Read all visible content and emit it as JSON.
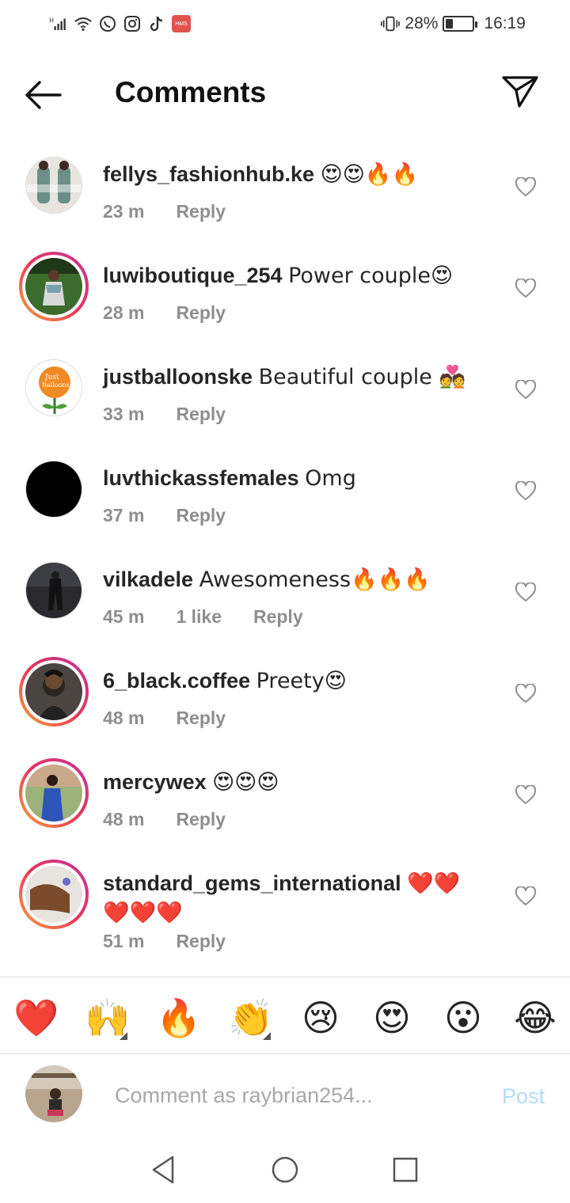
{
  "status_bar": {
    "signal_text": "H",
    "battery_text": "28%",
    "battery_level": 0.28,
    "time": "16:19",
    "icons": [
      "signal-icon",
      "wifi-icon",
      "whatsapp-icon",
      "instagram-icon",
      "tiktok-icon",
      "hms-icon",
      "vibrate-icon",
      "battery-icon"
    ],
    "hms_label": "HMS"
  },
  "header": {
    "title": "Comments",
    "back_icon": "back-arrow-icon",
    "share_icon": "send-icon"
  },
  "comments": [
    {
      "username": "fellys_fashionhub.ke",
      "text": "😍😍🔥🔥",
      "time": "23 m",
      "likes": "",
      "reply": "Reply",
      "ring": false
    },
    {
      "username": "luwiboutique_254",
      "text": "Power couple😍",
      "time": "28 m",
      "likes": "",
      "reply": "Reply",
      "ring": true
    },
    {
      "username": "justballoonske",
      "text": "Beautiful couple 💑",
      "time": "33 m",
      "likes": "",
      "reply": "Reply",
      "ring": false
    },
    {
      "username": "luvthickassfemales",
      "text": "Omg",
      "time": "37 m",
      "likes": "",
      "reply": "Reply",
      "ring": false
    },
    {
      "username": "vilkadele",
      "text": "Awesomeness🔥🔥🔥",
      "time": "45 m",
      "likes": "1 like",
      "reply": "Reply",
      "ring": false
    },
    {
      "username": "6_black.coffee",
      "text": "Preety😍",
      "time": "48 m",
      "likes": "",
      "reply": "Reply",
      "ring": true
    },
    {
      "username": "mercywex",
      "text": "😍😍😍",
      "time": "48 m",
      "likes": "",
      "reply": "Reply",
      "ring": true
    },
    {
      "username": "standard_gems_international",
      "text": "❤️❤️❤️❤️❤️",
      "time": "51 m",
      "likes": "",
      "reply": "Reply",
      "ring": true
    }
  ],
  "reactions": [
    "❤️",
    "🙌",
    "🔥",
    "👏",
    "😢",
    "😍",
    "😮",
    "😂"
  ],
  "composer": {
    "placeholder": "Comment as raybrian254...",
    "post_label": "Post"
  },
  "colors": {
    "ring_start": "#f9a43a",
    "ring_end": "#c1379a",
    "post_disabled": "#b3dbff",
    "meta": "#8e8e8e"
  }
}
